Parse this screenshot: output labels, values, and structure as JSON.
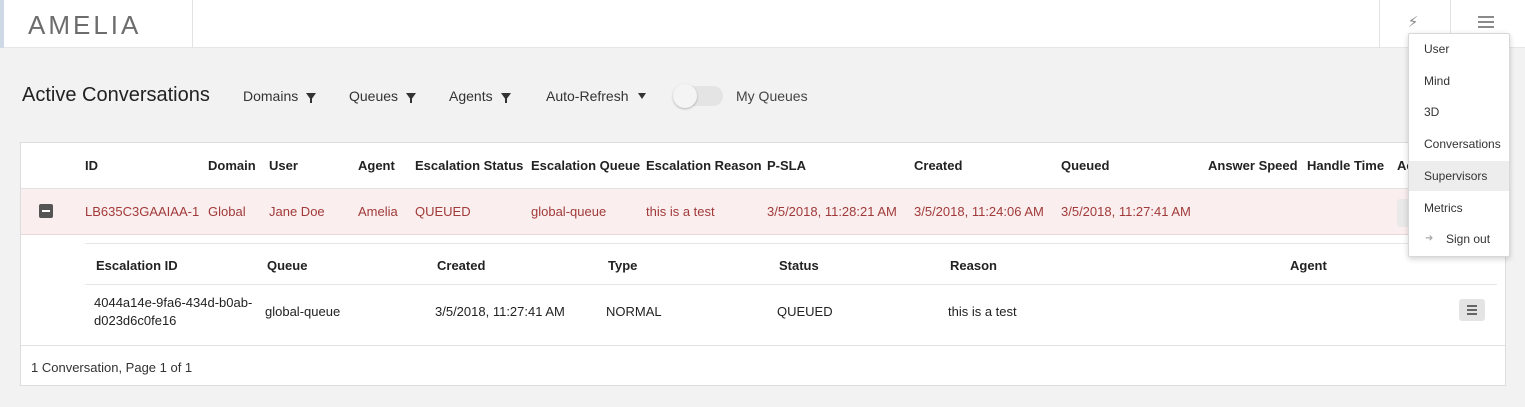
{
  "header": {
    "logo": "AMELIA"
  },
  "toolbar": {
    "title": "Active Conversations",
    "filters": [
      "Domains",
      "Queues",
      "Agents"
    ],
    "auto_refresh": "Auto-Refresh",
    "my_queues": "My Queues"
  },
  "table": {
    "columns": [
      "ID",
      "Domain",
      "User",
      "Agent",
      "Escalation Status",
      "Escalation Queue",
      "Escalation Reason",
      "P-SLA",
      "Created",
      "Queued",
      "Answer Speed",
      "Handle Time",
      "Ac"
    ],
    "row": {
      "id": "LB635C3GAAIAA-1",
      "domain": "Global",
      "user": "Jane Doe",
      "agent": "Amelia",
      "status": "QUEUED",
      "queue": "global-queue",
      "reason": "this is a test",
      "psla": "3/5/2018, 11:28:21 AM",
      "created": "3/5/2018, 11:24:06 AM",
      "queued": "3/5/2018, 11:27:41 AM"
    },
    "detail": {
      "columns": [
        "Escalation ID",
        "Queue",
        "Created",
        "Type",
        "Status",
        "Reason",
        "Agent"
      ],
      "escalation_id_line1": "4044a14e-9fa6-434d-b0ab-",
      "escalation_id_line2": "d023d6c0fe16",
      "queue": "global-queue",
      "created": "3/5/2018, 11:27:41 AM",
      "type": "NORMAL",
      "status": "QUEUED",
      "reason": "this is a test"
    },
    "footer": "1 Conversation, Page 1 of 1"
  },
  "menu": {
    "items": [
      "User",
      "Mind",
      "3D",
      "Conversations",
      "Supervisors",
      "Metrics"
    ],
    "active": "Supervisors",
    "sign_out": "Sign out"
  },
  "colors": {
    "row_highlight": "#fbeeee",
    "row_text": "#a13a3a"
  },
  "icons": [
    "bolt-icon",
    "hamburger-icon",
    "filter-icon",
    "caret-down-icon",
    "collapse-icon",
    "list-icon",
    "sign-out-icon"
  ]
}
